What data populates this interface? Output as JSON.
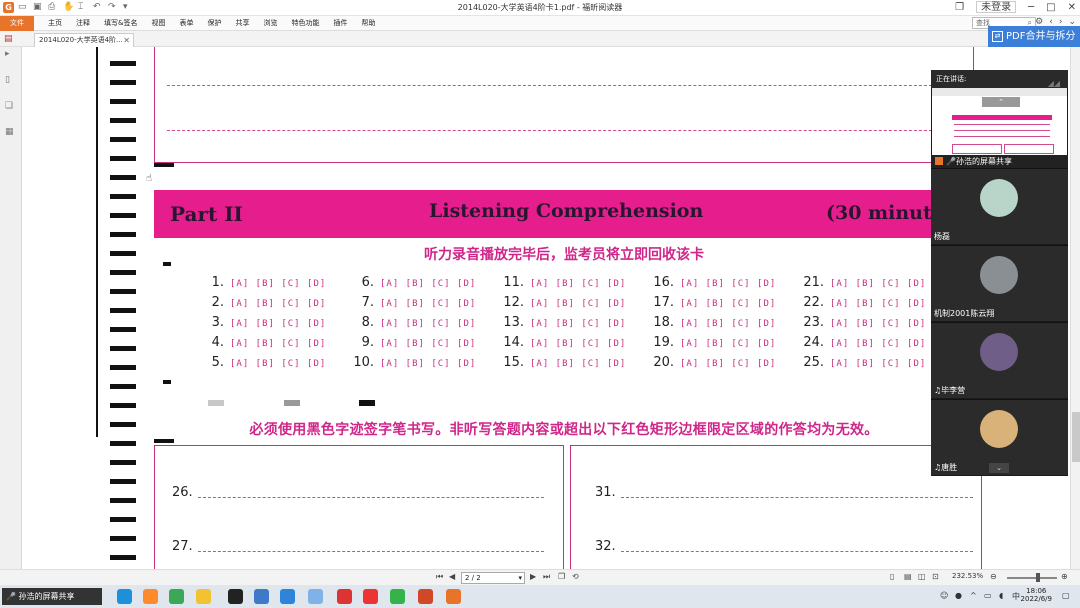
{
  "app": {
    "title": "2014L020-大学英语4阶卡1.pdf - 福昕阅读器",
    "file_menu": "文件",
    "menu": [
      "主页",
      "注释",
      "填写&签名",
      "视图",
      "表单",
      "保护",
      "共享",
      "浏览",
      "特色功能",
      "插件",
      "帮助"
    ],
    "login": "未登录",
    "search_placeholder": "查找",
    "tab_label": "2014L020-大学英语4阶...",
    "merge_button": "PDF合并与拆分",
    "colors": {
      "accent": "#e8742c",
      "magenta": "#e61d8c",
      "merge": "#3b7fd9"
    }
  },
  "document": {
    "part_label": "Part II",
    "section_title": "Listening Comprehension",
    "duration": "(30 minut",
    "notice_top": "听力录音播放完毕后，监考员将立即回收该卡",
    "notice_bottom": "必须使用黑色字迹签字笔书写。非听写答题内容或超出以下红色矩形边框限定区域的作答均为无效。",
    "options": "[A] [B] [C] [D]",
    "questions": [
      [
        "1.",
        "2.",
        "3.",
        "4.",
        "5."
      ],
      [
        "6.",
        "7.",
        "8.",
        "9.",
        "10."
      ],
      [
        "11.",
        "12.",
        "13.",
        "14.",
        "15."
      ],
      [
        "16.",
        "17.",
        "18.",
        "19.",
        "20."
      ],
      [
        "21.",
        "22.",
        "23.",
        "24.",
        "25."
      ]
    ],
    "fill_left": [
      "26.",
      "27."
    ],
    "fill_right": [
      "31.",
      "32."
    ]
  },
  "call": {
    "speaking": "正在讲话:",
    "sharing_label": "孙浩的屏幕共享",
    "participants": [
      {
        "name": "杨磊",
        "avatar_color": "#b9d4c8"
      },
      {
        "name": "机制2001陈云翔",
        "avatar_color": "#8a8f94"
      },
      {
        "name": "毕李营",
        "avatar_color": "#6e5e88"
      },
      {
        "name": "唐胜",
        "avatar_color": "#d9b27a"
      }
    ]
  },
  "status": {
    "page": "2 / 2",
    "zoom": "232.53%"
  },
  "taskbar": {
    "share_label": "孙浩的屏幕共享",
    "ime": "中",
    "time": "18:06",
    "date": "2022/6/9"
  }
}
